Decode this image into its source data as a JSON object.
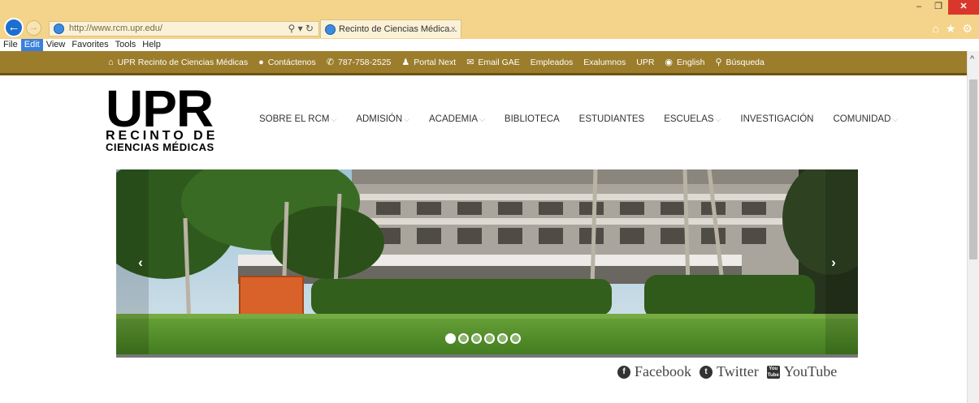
{
  "browser": {
    "address": "http://www.rcm.upr.edu/",
    "tab_title": "Recinto de Ciencias Médica...",
    "tab_close": "×",
    "window": {
      "minimize": "–",
      "restore": "❐",
      "close": "✕"
    },
    "menu": [
      "File",
      "Edit",
      "View",
      "Favorites",
      "Tools",
      "Help"
    ],
    "toolbar_icons": [
      "home-icon",
      "star-icon",
      "gear-icon"
    ]
  },
  "topbar": {
    "items": [
      {
        "icon": "home-icon",
        "glyph": "⌂",
        "label": "UPR Recinto de Ciencias Médicas"
      },
      {
        "icon": "info-icon",
        "glyph": "●",
        "label": "Contáctenos"
      },
      {
        "icon": "phone-icon",
        "glyph": "✆",
        "label": "787-758-2525"
      },
      {
        "icon": "user-icon",
        "glyph": "♟",
        "label": "Portal Next"
      },
      {
        "icon": "mail-icon",
        "glyph": "✉",
        "label": "Email GAE"
      },
      {
        "icon": "",
        "glyph": "",
        "label": "Empleados"
      },
      {
        "icon": "",
        "glyph": "",
        "label": "Exalumnos"
      },
      {
        "icon": "",
        "glyph": "",
        "label": "UPR"
      },
      {
        "icon": "globe-icon",
        "glyph": "◉",
        "label": "English"
      },
      {
        "icon": "search-icon",
        "glyph": "⚲",
        "label": "Búsqueda"
      }
    ],
    "bg_color": "#9c7d2c"
  },
  "logo": {
    "main": "UPR",
    "line1": "RECINTO DE",
    "line2": "CIENCIAS MÉDICAS"
  },
  "mainnav": [
    {
      "label": "SOBRE EL RCM",
      "dropdown": true
    },
    {
      "label": "ADMISIÓN",
      "dropdown": true
    },
    {
      "label": "ACADEMIA",
      "dropdown": true
    },
    {
      "label": "BIBLIOTECA",
      "dropdown": false
    },
    {
      "label": "ESTUDIANTES",
      "dropdown": false
    },
    {
      "label": "ESCUELAS",
      "dropdown": true
    },
    {
      "label": "INVESTIGACIÓN",
      "dropdown": false
    },
    {
      "label": "COMUNIDAD",
      "dropdown": true
    }
  ],
  "carousel": {
    "prev": "‹",
    "next": "›",
    "slide_count": 6,
    "active_index": 0
  },
  "social": [
    {
      "icon": "facebook-icon",
      "glyph": "f",
      "label": "Facebook"
    },
    {
      "icon": "twitter-icon",
      "glyph": "t",
      "label": "Twitter"
    },
    {
      "icon": "youtube-icon",
      "glyph": "You Tube",
      "label": "YouTube"
    }
  ]
}
